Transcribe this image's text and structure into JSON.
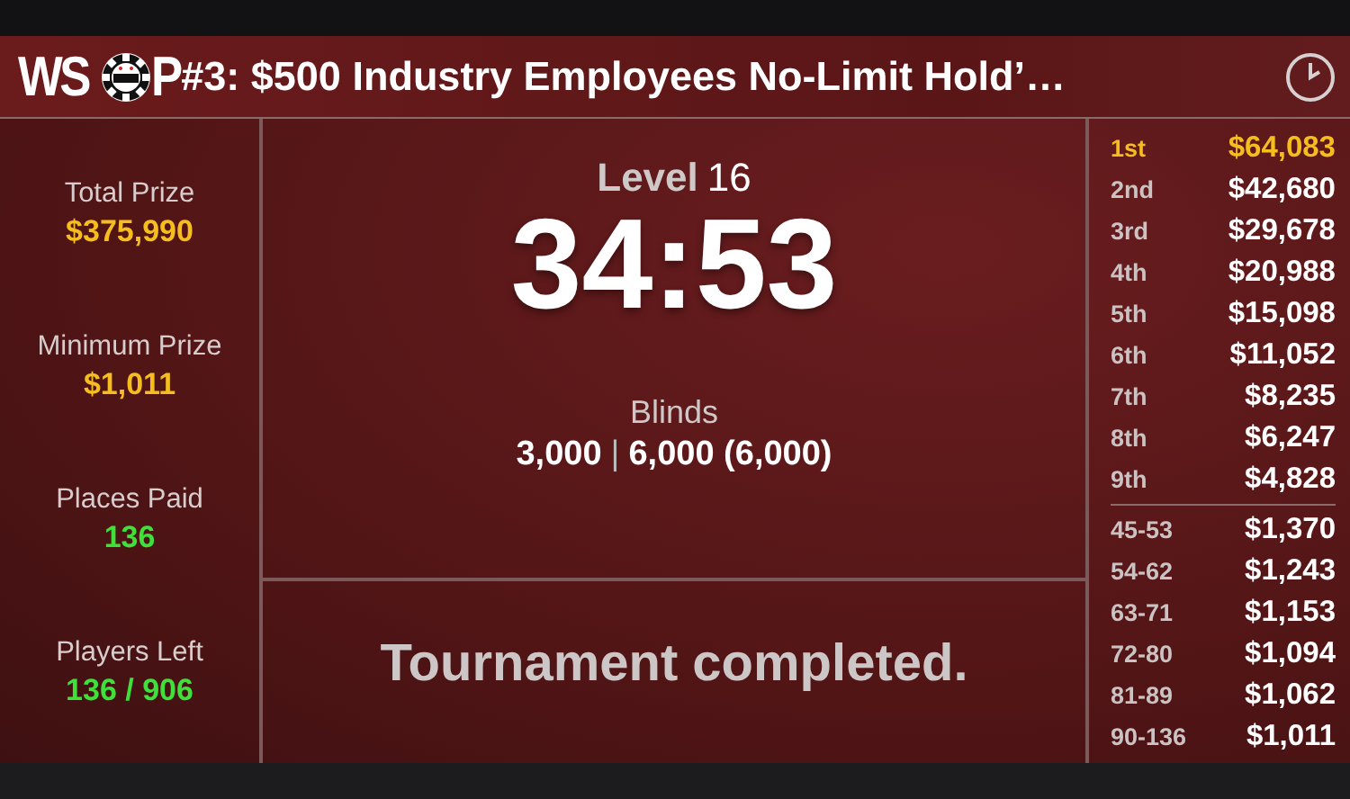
{
  "header": {
    "logo": {
      "left": "WS",
      "right": "P"
    },
    "title": "#3: $500 Industry Employees No-Limit Hold’…"
  },
  "stats": [
    {
      "label": "Total Prize",
      "value": "$375,990",
      "color": "#f5be1e"
    },
    {
      "label": "Minimum Prize",
      "value": "$1,011",
      "color": "#f5be1e"
    },
    {
      "label": "Places Paid",
      "value": "136",
      "color": "#3fe03a"
    },
    {
      "label": "Players Left",
      "value": "136 / 906",
      "color": "#3fe03a"
    }
  ],
  "clock": {
    "level_label": "Level",
    "level": "16",
    "time": "34:53",
    "blinds_label": "Blinds",
    "blinds_small": "3,000",
    "separator": "|",
    "blinds_big": "6,000 (6,000)"
  },
  "status": "Tournament completed.",
  "payouts": {
    "places": [
      {
        "place": "1st",
        "amount": "$64,083",
        "highlighted": true
      },
      {
        "place": "2nd",
        "amount": "$42,680",
        "highlighted": false
      },
      {
        "place": "3rd",
        "amount": "$29,678",
        "highlighted": false
      },
      {
        "place": "4th",
        "amount": "$20,988",
        "highlighted": false
      },
      {
        "place": "5th",
        "amount": "$15,098",
        "highlighted": false
      },
      {
        "place": "6th",
        "amount": "$11,052",
        "highlighted": false
      },
      {
        "place": "7th",
        "amount": "$8,235",
        "highlighted": false
      },
      {
        "place": "8th",
        "amount": "$6,247",
        "highlighted": false
      },
      {
        "place": "9th",
        "amount": "$4,828",
        "highlighted": false
      }
    ],
    "ranges": [
      {
        "place": "45-53",
        "amount": "$1,370",
        "highlighted": false
      },
      {
        "place": "54-62",
        "amount": "$1,243",
        "highlighted": false
      },
      {
        "place": "63-71",
        "amount": "$1,153",
        "highlighted": false
      },
      {
        "place": "72-80",
        "amount": "$1,094",
        "highlighted": false
      },
      {
        "place": "81-89",
        "amount": "$1,062",
        "highlighted": false
      },
      {
        "place": "90-136",
        "amount": "$1,011",
        "highlighted": false
      }
    ]
  }
}
